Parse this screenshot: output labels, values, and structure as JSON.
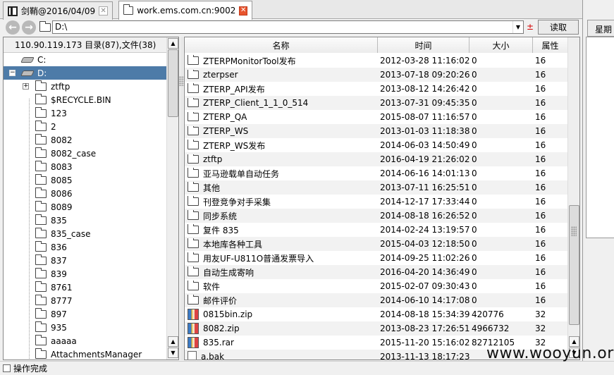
{
  "tabs": [
    {
      "label": "剑鞘@2016/04/09",
      "icon": "window-icon"
    },
    {
      "label": "work.ems.com.cn:9002",
      "icon": "folder-icon"
    }
  ],
  "toolbar": {
    "path": "D:\\",
    "plusminus": "±",
    "read_label": "读取"
  },
  "left": {
    "header": "110.90.119.173    目录(87),文件(38)",
    "drives": [
      {
        "label": "C:",
        "selected": false
      },
      {
        "label": "D:",
        "selected": true
      }
    ],
    "folders": [
      "ztftp",
      "$RECYCLE.BIN",
      "123",
      "2",
      "8082",
      "8082_case",
      "8083",
      "8085",
      "8086",
      "8089",
      "835",
      "835_case",
      "836",
      "837",
      "839",
      "8761",
      "8777",
      "897",
      "935",
      "aaaaa",
      "AttachmentsManager"
    ]
  },
  "right": {
    "columns": [
      "名称",
      "时间",
      "大小",
      "属性"
    ],
    "rows": [
      {
        "type": "folder",
        "name": "ZTERPMonitorTool发布",
        "time": "2012-03-28 11:16:02",
        "size": "0",
        "attr": "16"
      },
      {
        "type": "folder",
        "name": "zterpser",
        "time": "2013-07-18 09:20:26",
        "size": "0",
        "attr": "16"
      },
      {
        "type": "folder",
        "name": "ZTERP_API发布",
        "time": "2013-08-12 14:26:42",
        "size": "0",
        "attr": "16"
      },
      {
        "type": "folder",
        "name": "ZTERP_Client_1_1_0_514",
        "time": "2013-07-31 09:45:35",
        "size": "0",
        "attr": "16"
      },
      {
        "type": "folder",
        "name": "ZTERP_QA",
        "time": "2015-08-07 11:16:57",
        "size": "0",
        "attr": "16"
      },
      {
        "type": "folder",
        "name": "ZTERP_WS",
        "time": "2013-01-03 11:18:38",
        "size": "0",
        "attr": "16"
      },
      {
        "type": "folder",
        "name": "ZTERP_WS发布",
        "time": "2014-06-03 14:50:49",
        "size": "0",
        "attr": "16"
      },
      {
        "type": "folder",
        "name": "ztftp",
        "time": "2016-04-19 21:26:02",
        "size": "0",
        "attr": "16"
      },
      {
        "type": "folder",
        "name": "亚马逊载单自动任务",
        "time": "2014-06-16 14:01:13",
        "size": "0",
        "attr": "16"
      },
      {
        "type": "folder",
        "name": "其他",
        "time": "2013-07-11 16:25:51",
        "size": "0",
        "attr": "16"
      },
      {
        "type": "folder",
        "name": "刊登竞争对手采集",
        "time": "2014-12-17 17:33:44",
        "size": "0",
        "attr": "16"
      },
      {
        "type": "folder",
        "name": "同步系统",
        "time": "2014-08-18 16:26:52",
        "size": "0",
        "attr": "16"
      },
      {
        "type": "folder",
        "name": "复件 835",
        "time": "2014-02-24 13:19:57",
        "size": "0",
        "attr": "16"
      },
      {
        "type": "folder",
        "name": "本地库各种工具",
        "time": "2015-04-03 12:18:50",
        "size": "0",
        "attr": "16"
      },
      {
        "type": "folder",
        "name": "用友UF-U811O普通发票导入",
        "time": "2014-09-25 11:02:26",
        "size": "0",
        "attr": "16"
      },
      {
        "type": "folder",
        "name": "自动生成寄响",
        "time": "2016-04-20 14:36:49",
        "size": "0",
        "attr": "16"
      },
      {
        "type": "folder",
        "name": "软件",
        "time": "2015-02-07 09:30:43",
        "size": "0",
        "attr": "16"
      },
      {
        "type": "folder",
        "name": "邮件评价",
        "time": "2014-06-10 14:17:08",
        "size": "0",
        "attr": "16"
      },
      {
        "type": "zip",
        "name": "0815bin.zip",
        "time": "2014-08-18 15:34:39",
        "size": "420776",
        "attr": "32"
      },
      {
        "type": "zip",
        "name": "8082.zip",
        "time": "2013-08-23 17:26:51",
        "size": "4966732",
        "attr": "32"
      },
      {
        "type": "zip",
        "name": "835.rar",
        "time": "2015-11-20 15:16:02",
        "size": "82712105",
        "attr": "32"
      },
      {
        "type": "file",
        "name": "a.bak",
        "time": "2013-11-13 18:17:23",
        "size": "",
        "attr": ""
      }
    ]
  },
  "farright": {
    "tab_label": "星期"
  },
  "status": {
    "text": "操作完成"
  },
  "watermark": "www.wooyun.org"
}
